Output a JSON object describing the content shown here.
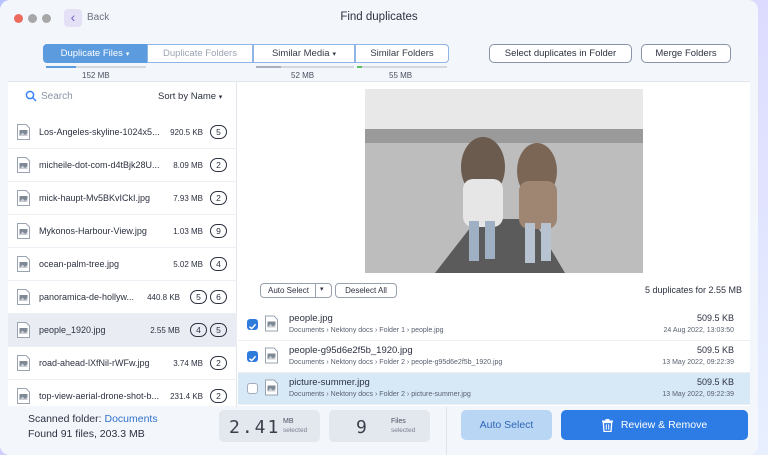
{
  "window": {
    "title": "Find duplicates",
    "back_label": "Back",
    "traffic_colors": [
      "#ed6a5e",
      "#a7a7a7",
      "#a7a7a7"
    ]
  },
  "tabs": [
    {
      "label": "Duplicate Files",
      "active": true,
      "chevron": true,
      "size": "152 MB"
    },
    {
      "label": "Duplicate Folders",
      "active": false,
      "chevron": false,
      "size": ""
    },
    {
      "label": "Similar Media",
      "active": false,
      "chevron": true,
      "size": "52 MB"
    },
    {
      "label": "Similar Folders",
      "active": false,
      "chevron": false,
      "size": "55 MB"
    }
  ],
  "actions": {
    "select_in_folder": "Select duplicates in Folder",
    "merge_folders": "Merge Folders"
  },
  "sidebar": {
    "search_placeholder": "Search",
    "sort_label": "Sort by Name",
    "files": [
      {
        "name": "Los-Angeles-skyline-1024x5...",
        "size": "920.5 KB",
        "count": "5"
      },
      {
        "name": "micheile-dot-com-d4tBjk28U...",
        "size": "8.09 MB",
        "count": "2"
      },
      {
        "name": "mick-haupt-Mv5BKvICkI.jpg",
        "size": "7.93 MB",
        "count": "2"
      },
      {
        "name": "Mykonos-Harbour-View.jpg",
        "size": "1.03 MB",
        "count": "9"
      },
      {
        "name": "ocean-palm-tree.jpg",
        "size": "5.02 MB",
        "count": "4"
      },
      {
        "name": "panoramica-de-hollyw...",
        "size": "440.8 KB",
        "count": "5",
        "count2": "6"
      },
      {
        "name": "people_1920.jpg",
        "size": "2.55 MB",
        "count": "4",
        "count2": "5"
      },
      {
        "name": "road-ahead-lXfNil-rWFw.jpg",
        "size": "3.74 MB",
        "count": "2"
      },
      {
        "name": "top-view-aerial-drone-shot-b...",
        "size": "231.4 KB",
        "count": "2"
      }
    ]
  },
  "detail": {
    "auto_select": "Auto Select",
    "deselect_all": "Deselect All",
    "dup_summary": "5 duplicates for 2.55 MB",
    "files": [
      {
        "name": "people.jpg",
        "path": [
          "Documents",
          "Nektony docs",
          "Folder 1",
          "people.jpg"
        ],
        "size": "509.5 KB",
        "date": "24 Aug 2022, 13:03:50",
        "checked": true
      },
      {
        "name": "people-g95d6e2f5b_1920.jpg",
        "path": [
          "Documents",
          "Nektony docs",
          "Folder 2",
          "people-g95d6e2f5b_1920.jpg"
        ],
        "size": "509.5 KB",
        "date": "13 May 2022, 09:22:39",
        "checked": true
      },
      {
        "name": "picture-summer.jpg",
        "path": [
          "Documents",
          "Nektony docs",
          "Folder 2",
          "picture-summer.jpg"
        ],
        "size": "509.5 KB",
        "date": "13 May 2022, 09:22:39",
        "checked": false
      }
    ]
  },
  "footer": {
    "scanned_prefix": "Scanned folder:",
    "scanned_folder": "Documents",
    "found": "Found 91 files, 203.3 MB",
    "selected_size": "2.41",
    "selected_size_unit": "MB",
    "selected_size_sub": "selected",
    "selected_files": "9",
    "selected_files_unit": "Files",
    "selected_files_sub": "selected",
    "auto_select": "Auto Select",
    "review_remove": "Review & Remove"
  },
  "colors": {
    "accent": "#2d7ce6",
    "tab_active": "#5b9bde",
    "link": "#2f72cc"
  }
}
